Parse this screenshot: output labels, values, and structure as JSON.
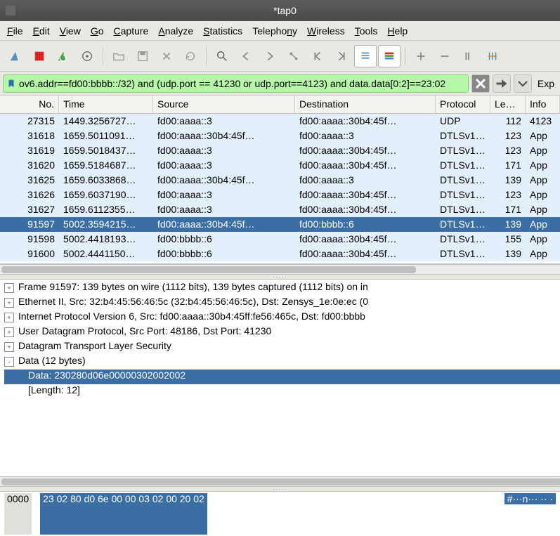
{
  "title": "*tap0",
  "menu": [
    "File",
    "Edit",
    "View",
    "Go",
    "Capture",
    "Analyze",
    "Statistics",
    "Telephony",
    "Wireless",
    "Tools",
    "Help"
  ],
  "menu_ul_idx": [
    0,
    0,
    0,
    0,
    0,
    0,
    0,
    7,
    0,
    0,
    0
  ],
  "filter": {
    "value": "ov6.addr==fd00:bbbb::/32) and (udp.port == 41230 or udp.port==4123) and data.data[0:2]==23:02",
    "right_label": "Exp"
  },
  "table": {
    "headers": [
      "No.",
      "Time",
      "Source",
      "Destination",
      "Protocol",
      "Length",
      "Info"
    ],
    "rows": [
      {
        "no": "27315",
        "time": "1449.3256727…",
        "src": "fd00:aaaa::3",
        "dst": "fd00:aaaa::30b4:45f…",
        "proto": "UDP",
        "len": "112",
        "info": "4123"
      },
      {
        "no": "31618",
        "time": "1659.5011091…",
        "src": "fd00:aaaa::30b4:45f…",
        "dst": "fd00:aaaa::3",
        "proto": "DTLSv1…",
        "len": "123",
        "info": "App"
      },
      {
        "no": "31619",
        "time": "1659.5018437…",
        "src": "fd00:aaaa::3",
        "dst": "fd00:aaaa::30b4:45f…",
        "proto": "DTLSv1…",
        "len": "123",
        "info": "App"
      },
      {
        "no": "31620",
        "time": "1659.5184687…",
        "src": "fd00:aaaa::3",
        "dst": "fd00:aaaa::30b4:45f…",
        "proto": "DTLSv1…",
        "len": "171",
        "info": "App"
      },
      {
        "no": "31625",
        "time": "1659.6033868…",
        "src": "fd00:aaaa::30b4:45f…",
        "dst": "fd00:aaaa::3",
        "proto": "DTLSv1…",
        "len": "139",
        "info": "App"
      },
      {
        "no": "31626",
        "time": "1659.6037190…",
        "src": "fd00:aaaa::3",
        "dst": "fd00:aaaa::30b4:45f…",
        "proto": "DTLSv1…",
        "len": "123",
        "info": "App"
      },
      {
        "no": "31627",
        "time": "1659.6112355…",
        "src": "fd00:aaaa::3",
        "dst": "fd00:aaaa::30b4:45f…",
        "proto": "DTLSv1…",
        "len": "171",
        "info": "App"
      },
      {
        "no": "91597",
        "time": "5002.3594215…",
        "src": "fd00:aaaa::30b4:45f…",
        "dst": "fd00:bbbb::6",
        "proto": "DTLSv1…",
        "len": "139",
        "info": "App",
        "sel": true
      },
      {
        "no": "91598",
        "time": "5002.4418193…",
        "src": "fd00:bbbb::6",
        "dst": "fd00:aaaa::30b4:45f…",
        "proto": "DTLSv1…",
        "len": "155",
        "info": "App"
      },
      {
        "no": "91600",
        "time": "5002.4441150…",
        "src": "fd00:bbbb::6",
        "dst": "fd00:aaaa::30b4:45f…",
        "proto": "DTLSv1…",
        "len": "139",
        "info": "App"
      }
    ]
  },
  "detail": [
    {
      "t": "+",
      "text": "Frame 91597: 139 bytes on wire (1112 bits), 139 bytes captured (1112 bits) on in"
    },
    {
      "t": "+",
      "text": "Ethernet II, Src: 32:b4:45:56:46:5c (32:b4:45:56:46:5c), Dst: Zensys_1e:0e:ec (0"
    },
    {
      "t": "+",
      "text": "Internet Protocol Version 6, Src: fd00:aaaa::30b4:45ff:fe56:465c, Dst: fd00:bbbb"
    },
    {
      "t": "+",
      "text": "User Datagram Protocol, Src Port: 48186, Dst Port: 41230"
    },
    {
      "t": "+",
      "text": "Datagram Transport Layer Security"
    },
    {
      "t": "-",
      "text": "Data (12 bytes)"
    },
    {
      "child": true,
      "sel": true,
      "text": "Data: 230280d06e00000302002002"
    },
    {
      "child": true,
      "text": "[Length: 12]"
    }
  ],
  "hex": {
    "offset": "0000",
    "bytes": "23 02 80 d0 6e 00 00 03  02 00 20 02",
    "ascii": "#···n··· ·· ·"
  },
  "icons": {
    "fin": "fin",
    "stop": "stop",
    "restart": "restart",
    "options": "options",
    "open": "open",
    "save": "save",
    "close": "close",
    "reload": "reload",
    "find": "find",
    "back": "back",
    "fwd": "fwd",
    "jump": "jump",
    "first": "first",
    "last": "last",
    "autoscroll": "autoscroll",
    "colorize": "colorize",
    "zoomin": "zoomin",
    "zoomout": "zoomout",
    "zoom1": "zoom1",
    "resize": "resize"
  }
}
